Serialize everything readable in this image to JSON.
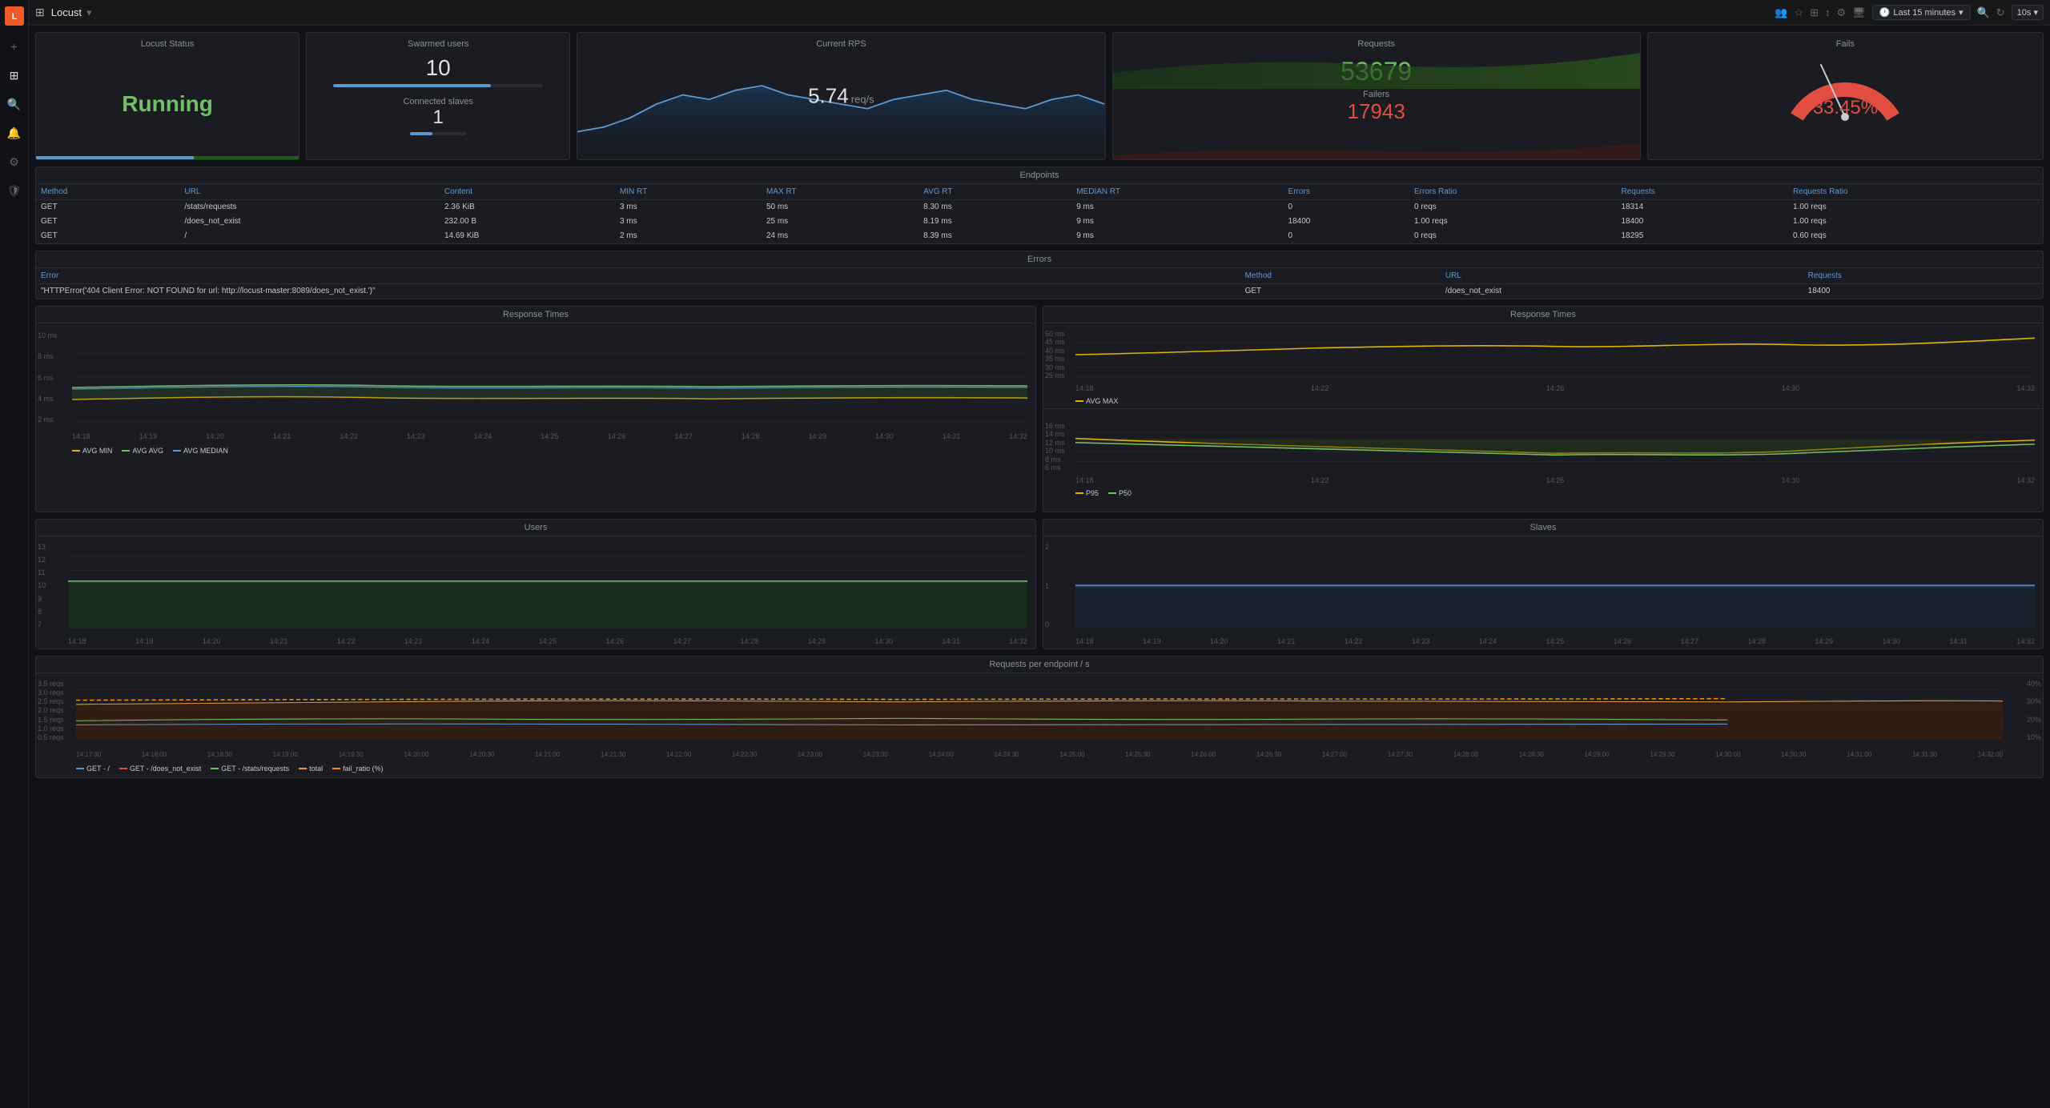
{
  "app": {
    "name": "Locust",
    "logo": "L"
  },
  "topbar": {
    "title": "Locust",
    "dropdown_icon": "▾",
    "time_range": "Last 15 minutes",
    "refresh_rate": "10s",
    "icons": [
      "👥",
      "☆",
      "⊞",
      "↕",
      "⚙",
      "🖥"
    ]
  },
  "sidebar": {
    "items": [
      {
        "icon": "+",
        "name": "add"
      },
      {
        "icon": "⊞",
        "name": "dashboard"
      },
      {
        "icon": "🔍",
        "name": "search"
      },
      {
        "icon": "🔔",
        "name": "notifications"
      },
      {
        "icon": "⚙",
        "name": "settings"
      },
      {
        "icon": "🛡",
        "name": "shield"
      }
    ]
  },
  "panels": {
    "locust_status": {
      "title": "Locust Status",
      "value": "Running"
    },
    "swarmed_users": {
      "title": "Swarmed users",
      "value": "10",
      "progress": 75,
      "connected_slaves_label": "Connected slaves",
      "connected_slaves_value": "1",
      "slaves_progress": 40
    },
    "current_rps": {
      "title": "Current RPS",
      "value": "5.74",
      "unit": "req/s"
    },
    "requests": {
      "title": "Requests",
      "value": "53679",
      "failers_label": "Failers",
      "failers_value": "17943"
    },
    "fails": {
      "title": "Fails",
      "value": "33.45%"
    }
  },
  "endpoints_table": {
    "title": "Endpoints",
    "columns": [
      "Method",
      "URL",
      "Content",
      "MIN RT",
      "MAX RT",
      "AVG RT",
      "MEDIAN RT",
      "Errors",
      "Errors Ratio",
      "Requests",
      "Requests Ratio"
    ],
    "rows": [
      [
        "GET",
        "/stats/requests",
        "2.36 KiB",
        "3 ms",
        "50 ms",
        "8.30 ms",
        "9 ms",
        "0",
        "0 reqs",
        "18314",
        "1.00 reqs"
      ],
      [
        "GET",
        "/does_not_exist",
        "232.00 B",
        "3 ms",
        "25 ms",
        "8.19 ms",
        "9 ms",
        "18400",
        "1.00 reqs",
        "18400",
        "1.00 reqs"
      ],
      [
        "GET",
        "/",
        "14.69 KiB",
        "2 ms",
        "24 ms",
        "8.39 ms",
        "9 ms",
        "0",
        "0 reqs",
        "18295",
        "0.60 reqs"
      ]
    ]
  },
  "errors_table": {
    "title": "Errors",
    "columns": [
      "Error",
      "Method",
      "URL",
      "Requests"
    ],
    "rows": [
      [
        "\"HTTPError('404 Client Error: NOT FOUND for url: http://locust-master:8089/does_not_exist.')",
        "GET",
        "/does_not_exist",
        "18400"
      ]
    ]
  },
  "response_times": {
    "title": "Response Times",
    "y_labels_left": [
      "10 ms",
      "8 ms",
      "6 ms",
      "4 ms",
      "2 ms"
    ],
    "y_labels_right_top": [
      "50 ms",
      "45 ms",
      "40 ms",
      "35 ms",
      "30 ms",
      "25 ms"
    ],
    "y_labels_right_bottom": [
      "16 ms",
      "14 ms",
      "12 ms",
      "10 ms",
      "8 ms",
      "6 ms"
    ],
    "x_labels": [
      "14:18",
      "14:19",
      "14:20",
      "14:21",
      "14:22",
      "14:23",
      "14:24",
      "14:25",
      "14:26",
      "14:27",
      "14:28",
      "14:29",
      "14:30",
      "14:31",
      "14:32"
    ],
    "legend_left": [
      "AVG MIN",
      "AVG AVG",
      "AVG MEDIAN"
    ],
    "legend_right_top": [
      "AVG MAX"
    ],
    "legend_right_bottom": [
      "P95",
      "P50"
    ]
  },
  "users_chart": {
    "title": "Users",
    "y_labels": [
      "13",
      "12",
      "11",
      "10",
      "9",
      "8",
      "7"
    ],
    "x_labels": [
      "14:18",
      "14:19",
      "14:20",
      "14:21",
      "14:22",
      "14:23",
      "14:24",
      "14:25",
      "14:26",
      "14:27",
      "14:28",
      "14:29",
      "14:30",
      "14:31",
      "14:32"
    ]
  },
  "slaves_chart": {
    "title": "Slaves",
    "y_labels": [
      "2",
      "1",
      "0"
    ],
    "x_labels": [
      "14:18",
      "14:19",
      "14:20",
      "14:21",
      "14:22",
      "14:23",
      "14:24",
      "14:25",
      "14:26",
      "14:27",
      "14:28",
      "14:29",
      "14:30",
      "14:31",
      "14:32"
    ]
  },
  "requests_endpoint": {
    "title": "Requests per endpoint / s",
    "y_labels": [
      "3.5 reqs",
      "3.0 reqs",
      "2.5 reqs",
      "2.0 reqs",
      "1.5 reqs",
      "1.0 reqs",
      "0.5 reqs"
    ],
    "y_labels_right": [
      "40%",
      "30%",
      "20%",
      "10%"
    ],
    "x_labels": [
      "14:17:30",
      "14:18:00",
      "14:18:30",
      "14:19:00",
      "14:19:30",
      "14:20:00",
      "14:20:30",
      "14:21:00",
      "14:21:30",
      "14:22:00",
      "14:22:30",
      "14:23:00",
      "14:23:30",
      "14:24:00",
      "14:24:30",
      "14:25:00",
      "14:25:30",
      "14:26:00",
      "14:26:30",
      "14:27:00",
      "14:27:30",
      "14:28:00",
      "14:28:30",
      "14:29:00",
      "14:29:30",
      "14:30:00",
      "14:30:30",
      "14:31:00",
      "14:31:30",
      "14:32:00"
    ],
    "legend": [
      "GET - /",
      "GET - /does_not_exist",
      "GET - /stats/requests",
      "total",
      "fail_ratio (%)"
    ]
  },
  "colors": {
    "green": "#73bf69",
    "red": "#e24d42",
    "blue": "#5d98d1",
    "yellow": "#e0b400",
    "orange": "#f05a28",
    "teal": "#3ba0b0",
    "accent": "#5d98d1"
  }
}
